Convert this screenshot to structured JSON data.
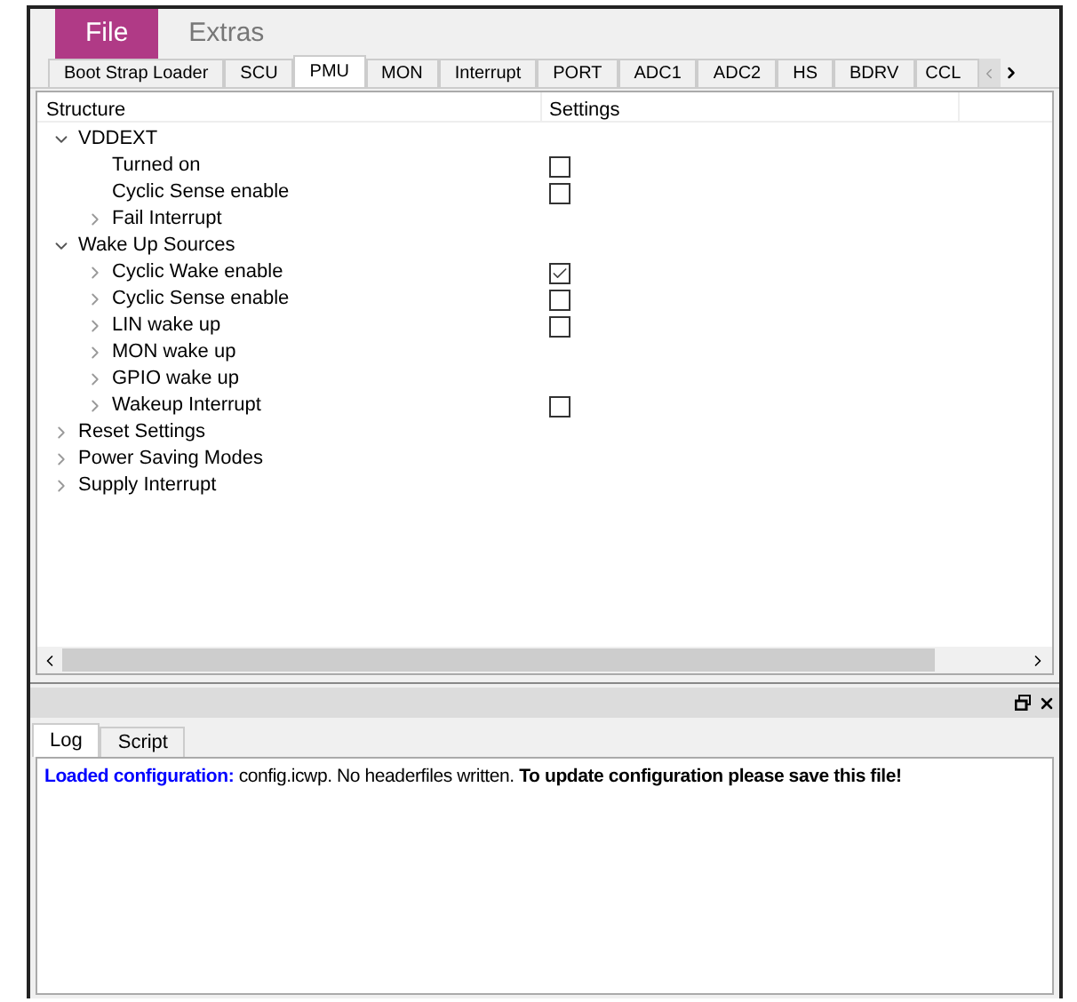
{
  "menu": [
    {
      "label": "File",
      "selected": true
    },
    {
      "label": "Extras",
      "selected": false
    }
  ],
  "tabs": [
    {
      "label": "Boot Strap Loader",
      "selected": false
    },
    {
      "label": "SCU",
      "selected": false
    },
    {
      "label": "PMU",
      "selected": true
    },
    {
      "label": "MON",
      "selected": false
    },
    {
      "label": "Interrupt",
      "selected": false
    },
    {
      "label": "PORT",
      "selected": false
    },
    {
      "label": "ADC1",
      "selected": false
    },
    {
      "label": "ADC2",
      "selected": false
    },
    {
      "label": "HS",
      "selected": false
    },
    {
      "label": "BDRV",
      "selected": false
    },
    {
      "label": "CCL",
      "selected": false
    }
  ],
  "tree": {
    "columns": [
      "Structure",
      "Settings"
    ],
    "items": [
      {
        "label": "VDDEXT",
        "expanded": true,
        "children": [
          {
            "label": "Turned on",
            "checked": false
          },
          {
            "label": "Cyclic Sense enable",
            "checked": false
          },
          {
            "label": "Fail Interrupt",
            "expanded": false
          }
        ]
      },
      {
        "label": "Wake Up Sources",
        "expanded": true,
        "children": [
          {
            "label": "Cyclic Wake enable",
            "expanded": false,
            "checked": true
          },
          {
            "label": "Cyclic Sense enable",
            "expanded": false,
            "checked": false
          },
          {
            "label": "LIN wake up",
            "expanded": false,
            "checked": false
          },
          {
            "label": "MON wake up",
            "expanded": false
          },
          {
            "label": "GPIO wake up",
            "expanded": false
          },
          {
            "label": "Wakeup Interrupt",
            "expanded": false,
            "checked": false
          }
        ]
      },
      {
        "label": "Reset Settings",
        "expanded": false
      },
      {
        "label": "Power Saving Modes",
        "expanded": false
      },
      {
        "label": "Supply Interrupt",
        "expanded": false
      }
    ]
  },
  "log_tabs": [
    {
      "label": "Log",
      "selected": true
    },
    {
      "label": "Script",
      "selected": false
    }
  ],
  "log": [
    {
      "kind": "label",
      "text": "Loaded configuration:"
    },
    {
      "kind": "plain",
      "text": " config.icwp. No headerfiles written. "
    },
    {
      "kind": "emphasis",
      "text": "To update configuration please save this file!"
    }
  ]
}
